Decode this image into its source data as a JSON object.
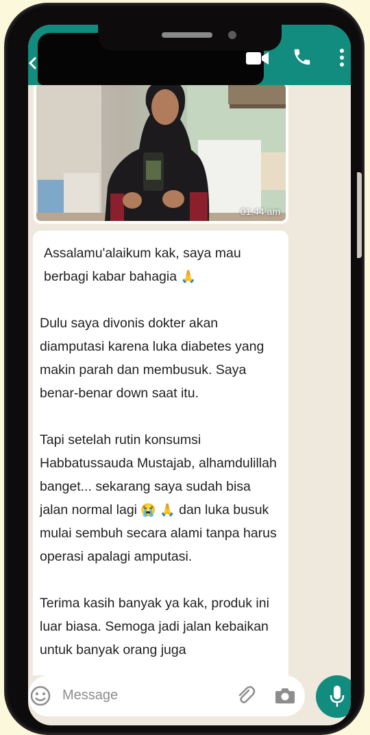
{
  "header": {
    "contact_name": "",
    "accent_color": "#128c7e",
    "icons": [
      "back-arrow-icon",
      "video-call-icon",
      "voice-call-icon",
      "more-options-icon"
    ]
  },
  "image_message": {
    "time": "01:44 am"
  },
  "text_message": {
    "paragraphs": [
      {
        "text": "Assalamu'alaikum kak, saya mau berbagi kabar bahagia",
        "emoji_after": "🙏"
      },
      {
        "text": "Dulu saya divonis dokter akan diamputasi karena luka diabetes yang makin parah dan membusuk. Saya benar-benar down saat itu."
      },
      {
        "text_1": "Tapi setelah rutin konsumsi Habbatussauda Mustajab, alhamdulillah banget... sekarang saya sudah bisa jalan normal lagi",
        "emoji_1": "😭",
        "emoji_2": "🙏",
        "text_2": "dan luka busuk mulai sembuh secara alami tanpa harus operasi apalagi amputasi."
      },
      {
        "text": "Terima kasih banyak ya kak, produk ini luar biasa. Semoga jadi jalan kebaikan untuk banyak orang juga"
      }
    ]
  },
  "input_bar": {
    "placeholder": "Message"
  }
}
